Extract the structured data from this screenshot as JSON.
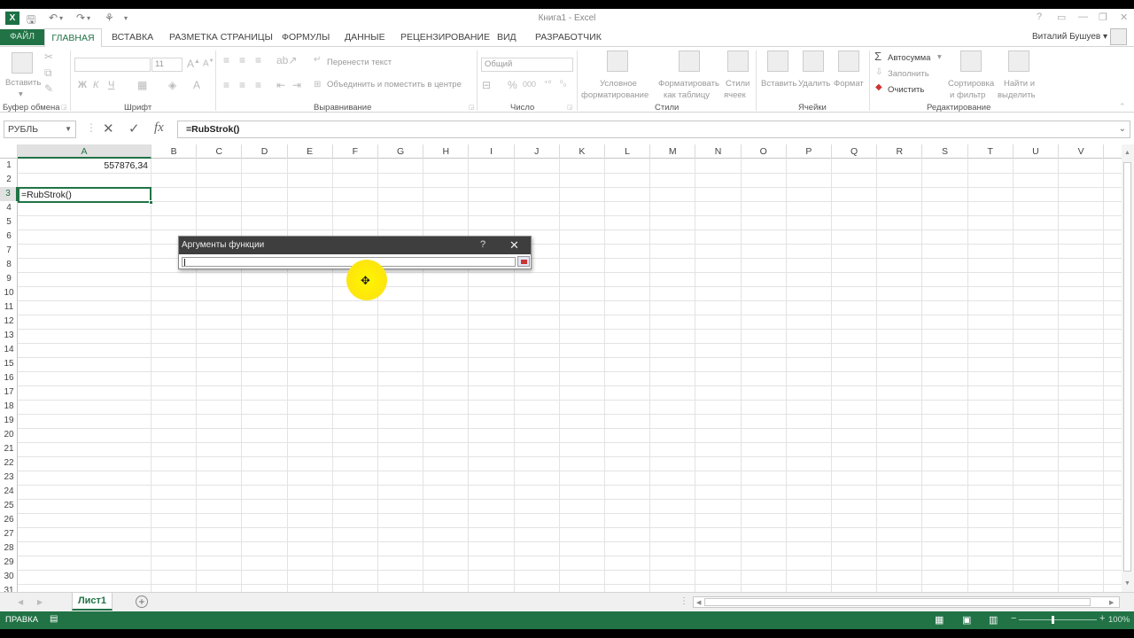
{
  "window": {
    "title": "Книга1 - Excel",
    "app_icon_text": "X",
    "qa_icons": [
      "save-icon",
      "undo-icon",
      "redo-icon",
      "touch-mode-icon",
      "customize-icon"
    ],
    "controls": [
      "?",
      "▭",
      "—",
      "❐",
      "✕"
    ]
  },
  "tabs": {
    "file": "ФАЙЛ",
    "items": [
      "ГЛАВНАЯ",
      "ВСТАВКА",
      "РАЗМЕТКА СТРАНИЦЫ",
      "ФОРМУЛЫ",
      "ДАННЫЕ",
      "РЕЦЕНЗИРОВАНИЕ",
      "ВИД",
      "РАЗРАБОТЧИК"
    ],
    "active": "ГЛАВНАЯ",
    "user": "Виталий Бушуев ▾"
  },
  "ribbon": {
    "clipboard": {
      "paste": "Вставить",
      "label": "Буфер обмена"
    },
    "font": {
      "size": "11",
      "bold": "Ж",
      "italic": "К",
      "underline": "Ч",
      "label": "Шрифт"
    },
    "alignment": {
      "wrap": "Перенести текст",
      "merge": "Объединить и поместить в центре",
      "label": "Выравнивание"
    },
    "number": {
      "format": "Общий",
      "label": "Число"
    },
    "styles": {
      "conditional_1": "Условное",
      "conditional_2": "форматирование",
      "table_1": "Форматировать",
      "table_2": "как таблицу",
      "cell_1": "Стили",
      "cell_2": "ячеек",
      "label": "Стили"
    },
    "cells": {
      "insert": "Вставить",
      "delete": "Удалить",
      "format": "Формат",
      "label": "Ячейки"
    },
    "editing": {
      "autosum": "Автосумма",
      "fill": "Заполнить",
      "clear": "Очистить",
      "sort_1": "Сортировка",
      "sort_2": "и фильтр",
      "find_1": "Найти и",
      "find_2": "выделить",
      "label": "Редактирование"
    }
  },
  "formula_bar": {
    "name_box": "РУБЛЬ",
    "formula": "=RubStrok()",
    "fx": "fx"
  },
  "sheet": {
    "columns": [
      "A",
      "B",
      "C",
      "D",
      "E",
      "F",
      "G",
      "H",
      "I",
      "J",
      "K",
      "L",
      "M",
      "N",
      "O",
      "P",
      "Q",
      "R",
      "S",
      "T",
      "U",
      "V"
    ],
    "selected_column": "A",
    "selected_row": 3,
    "rows": [
      "1",
      "2",
      "3",
      "4",
      "5",
      "6",
      "7",
      "8",
      "9",
      "10",
      "11",
      "12",
      "13",
      "14",
      "15",
      "16",
      "17",
      "18",
      "19",
      "20",
      "21",
      "22",
      "23",
      "24",
      "25",
      "26",
      "27",
      "28",
      "29",
      "30",
      "31"
    ],
    "cells": {
      "A1": "557876,34",
      "A3": "=RubStrok()"
    }
  },
  "sheet_tabs": {
    "active": "Лист1",
    "add": "+"
  },
  "status": {
    "mode": "ПРАВКА",
    "zoom": "100%"
  },
  "dialog": {
    "title": "Аргументы функции",
    "help": "?",
    "close": "✕"
  },
  "colors": {
    "accent": "#217346",
    "dialog_header": "#3e3e3e",
    "cursor_highlight": "#fde70b"
  }
}
